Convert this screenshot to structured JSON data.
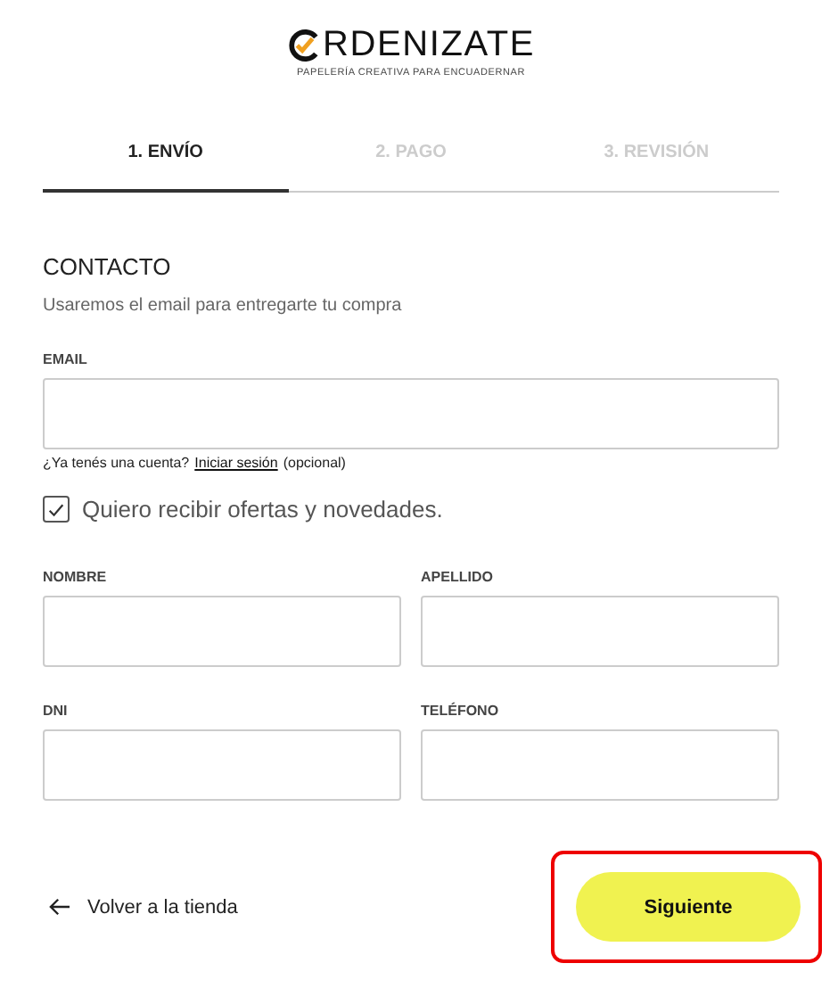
{
  "logo": {
    "wordmark": "RDENIZATE",
    "tagline": "PAPELERÍA CREATIVA PARA ENCUADERNAR"
  },
  "tabs": [
    {
      "label": "1. ENVÍO",
      "selected": true
    },
    {
      "label": "2. PAGO",
      "selected": false
    },
    {
      "label": "3. REVISIÓN",
      "selected": false
    }
  ],
  "section": {
    "title": "CONTACTO",
    "subtitle": "Usaremos el email para entregarte tu compra"
  },
  "email": {
    "label": "EMAIL",
    "hint_before": "¿Ya tenés una cuenta?",
    "link": "Iniciar sesión",
    "hint_after": "(opcional)"
  },
  "newsletter": {
    "label": "Quiero recibir ofertas y novedades.",
    "checked": true
  },
  "fields": [
    {
      "label": "NOMBRE"
    },
    {
      "label": "APELLIDO"
    },
    {
      "label": "DNI"
    },
    {
      "label": "TELÉFONO"
    }
  ],
  "back_link": "Volver a la tienda",
  "next_button": {
    "label": "Siguiente",
    "highlighted": true
  }
}
